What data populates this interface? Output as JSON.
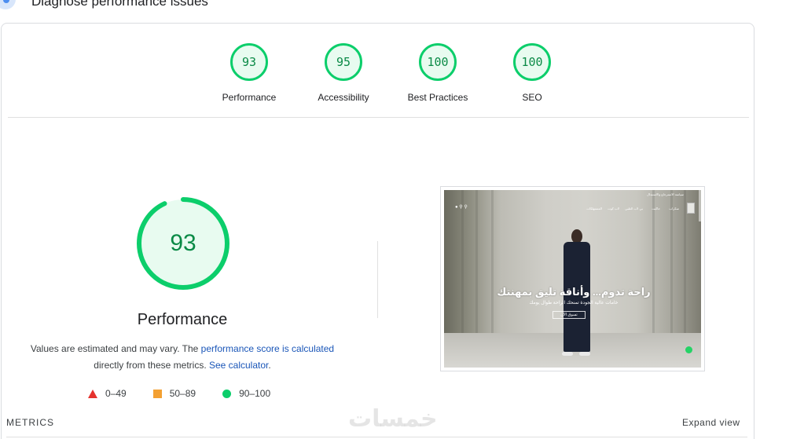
{
  "header": {
    "title": "Diagnose performance issues",
    "icon": "diagnose-icon"
  },
  "categories": [
    {
      "score": "93",
      "label": "Performance"
    },
    {
      "score": "95",
      "label": "Accessibility"
    },
    {
      "score": "100",
      "label": "Best Practices"
    },
    {
      "score": "100",
      "label": "SEO"
    }
  ],
  "performance": {
    "score": "93",
    "score_fraction": 0.93,
    "title": "Performance",
    "desc_prefix": "Values are estimated and may vary. The ",
    "desc_link": "performance score is calculated",
    "desc_middle": "directly from these metrics. ",
    "desc_link2": "See calculator",
    "desc_suffix": "."
  },
  "legend": [
    {
      "range": "0–49",
      "shape": "triangle",
      "color": "#e5322d"
    },
    {
      "range": "50–89",
      "shape": "square",
      "color": "#f3a032"
    },
    {
      "range": "90–100",
      "shape": "circle",
      "color": "#0cce6b"
    }
  ],
  "screenshot": {
    "hero_title": "راحة تدوم... وأناقة تليق بمهنتك",
    "hero_subtitle": "خامات عالية الجودة تمنحك الراحة طوال يومك",
    "hero_button": "تسوق الآن",
    "nav_items": [
      "سكراب",
      "جاكيت",
      "بي لاب الطبي",
      "لاب كوت",
      "المستهلكات"
    ],
    "top_text": "سياسة الاسترجاع والاستبدال"
  },
  "metrics": {
    "label": "METRICS",
    "expand": "Expand view"
  },
  "watermark": "خمسات",
  "colors": {
    "good": "#0cce6b",
    "good_text": "#0a8a46",
    "good_bg": "#e8fbf0",
    "link": "#1a56b8"
  }
}
